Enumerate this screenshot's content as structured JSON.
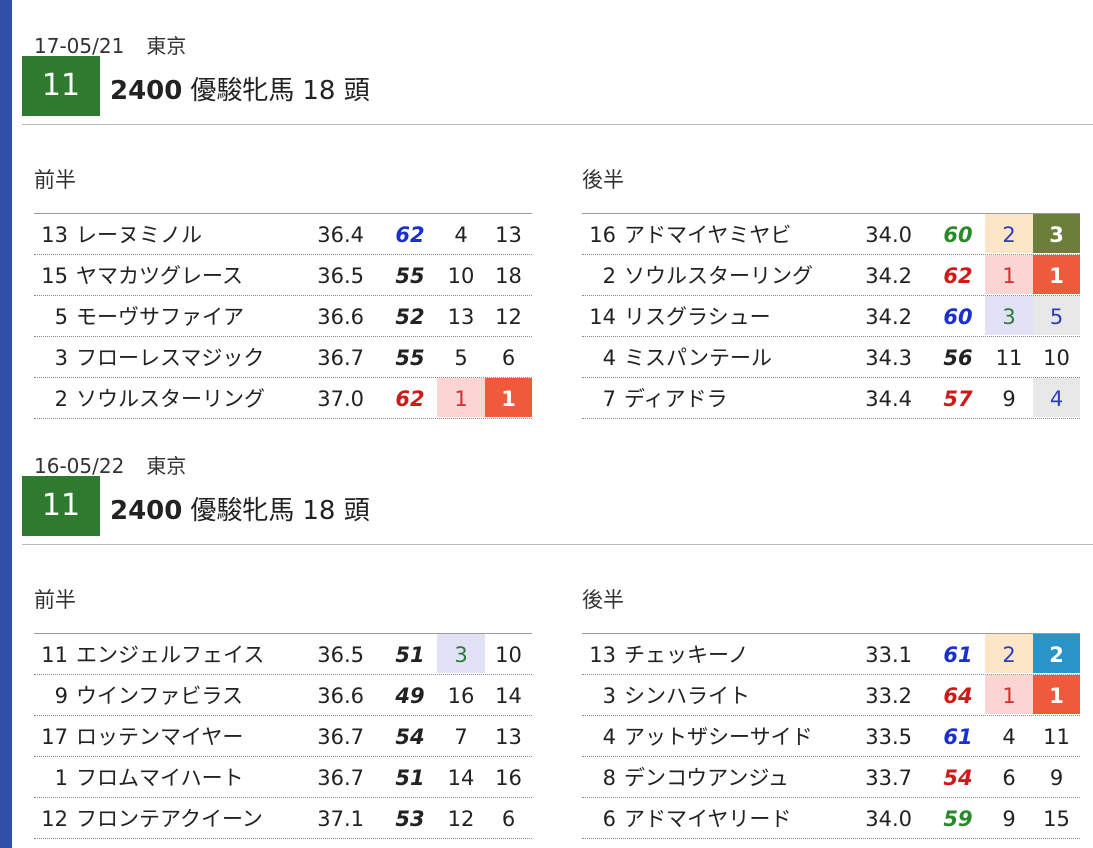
{
  "races": [
    {
      "date": "17-05/21",
      "venue": "東京",
      "race_no": "11",
      "distance": "2400",
      "name": "優駿牝馬",
      "field": "18 頭",
      "halves": [
        {
          "label": "前半",
          "rows": [
            {
              "no": "13",
              "name": "レーヌミノル",
              "time": "36.4",
              "idx": "62",
              "idx_color": "#1a2fd0",
              "r1": "4",
              "r2": "13",
              "r1_style": "",
              "r2_style": ""
            },
            {
              "no": "15",
              "name": "ヤマカツグレース",
              "time": "36.5",
              "idx": "55",
              "idx_color": "#222222",
              "r1": "10",
              "r2": "18",
              "r1_style": "",
              "r2_style": ""
            },
            {
              "no": "5",
              "name": "モーヴサファイア",
              "time": "36.6",
              "idx": "52",
              "idx_color": "#222222",
              "r1": "13",
              "r2": "12",
              "r1_style": "",
              "r2_style": ""
            },
            {
              "no": "3",
              "name": "フローレスマジック",
              "time": "36.7",
              "idx": "55",
              "idx_color": "#222222",
              "r1": "5",
              "r2": "6",
              "r1_style": "",
              "r2_style": ""
            },
            {
              "no": "2",
              "name": "ソウルスターリング",
              "time": "37.0",
              "idx": "62",
              "idx_color": "#d01a1a",
              "r1": "1",
              "r2": "1",
              "r1_style": "p1",
              "r2_style": "f1"
            }
          ]
        },
        {
          "label": "後半",
          "rows": [
            {
              "no": "16",
              "name": "アドマイヤミヤビ",
              "time": "34.0",
              "idx": "60",
              "idx_color": "#2a8a2a",
              "r1": "2",
              "r2": "3",
              "r1_style": "p2",
              "r2_style": "fol"
            },
            {
              "no": "2",
              "name": "ソウルスターリング",
              "time": "34.2",
              "idx": "62",
              "idx_color": "#d01a1a",
              "r1": "1",
              "r2": "1",
              "r1_style": "p1",
              "r2_style": "f1"
            },
            {
              "no": "14",
              "name": "リスグラシュー",
              "time": "34.2",
              "idx": "60",
              "idx_color": "#1a2fd0",
              "r1": "3",
              "r2": "5",
              "r1_style": "p3",
              "r2_style": "pgrey"
            },
            {
              "no": "4",
              "name": "ミスパンテール",
              "time": "34.3",
              "idx": "56",
              "idx_color": "#222222",
              "r1": "11",
              "r2": "10",
              "r1_style": "",
              "r2_style": ""
            },
            {
              "no": "7",
              "name": "ディアドラ",
              "time": "34.4",
              "idx": "57",
              "idx_color": "#d01a1a",
              "r1": "9",
              "r2": "4",
              "r1_style": "",
              "r2_style": "pgrey"
            }
          ]
        }
      ]
    },
    {
      "date": "16-05/22",
      "venue": "東京",
      "race_no": "11",
      "distance": "2400",
      "name": "優駿牝馬",
      "field": "18 頭",
      "halves": [
        {
          "label": "前半",
          "rows": [
            {
              "no": "11",
              "name": "エンジェルフェイス",
              "time": "36.5",
              "idx": "51",
              "idx_color": "#222222",
              "r1": "3",
              "r2": "10",
              "r1_style": "p3",
              "r2_style": ""
            },
            {
              "no": "9",
              "name": "ウインファビラス",
              "time": "36.6",
              "idx": "49",
              "idx_color": "#222222",
              "r1": "16",
              "r2": "14",
              "r1_style": "",
              "r2_style": ""
            },
            {
              "no": "17",
              "name": "ロッテンマイヤー",
              "time": "36.7",
              "idx": "54",
              "idx_color": "#222222",
              "r1": "7",
              "r2": "13",
              "r1_style": "",
              "r2_style": ""
            },
            {
              "no": "1",
              "name": "フロムマイハート",
              "time": "36.7",
              "idx": "51",
              "idx_color": "#222222",
              "r1": "14",
              "r2": "16",
              "r1_style": "",
              "r2_style": ""
            },
            {
              "no": "12",
              "name": "フロンテアクイーン",
              "time": "37.1",
              "idx": "53",
              "idx_color": "#222222",
              "r1": "12",
              "r2": "6",
              "r1_style": "",
              "r2_style": ""
            }
          ]
        },
        {
          "label": "後半",
          "rows": [
            {
              "no": "13",
              "name": "チェッキーノ",
              "time": "33.1",
              "idx": "61",
              "idx_color": "#1a2fd0",
              "r1": "2",
              "r2": "2",
              "r1_style": "p2",
              "r2_style": "fbl"
            },
            {
              "no": "3",
              "name": "シンハライト",
              "time": "33.2",
              "idx": "64",
              "idx_color": "#d01a1a",
              "r1": "1",
              "r2": "1",
              "r1_style": "p1",
              "r2_style": "f1"
            },
            {
              "no": "4",
              "name": "アットザシーサイド",
              "time": "33.5",
              "idx": "61",
              "idx_color": "#1a2fd0",
              "r1": "4",
              "r2": "11",
              "r1_style": "",
              "r2_style": ""
            },
            {
              "no": "8",
              "name": "デンコウアンジュ",
              "time": "33.7",
              "idx": "54",
              "idx_color": "#d01a1a",
              "r1": "6",
              "r2": "9",
              "r1_style": "",
              "r2_style": ""
            },
            {
              "no": "6",
              "name": "アドマイヤリード",
              "time": "34.0",
              "idx": "59",
              "idx_color": "#2a8a2a",
              "r1": "9",
              "r2": "15",
              "r1_style": "",
              "r2_style": ""
            }
          ]
        }
      ]
    }
  ]
}
